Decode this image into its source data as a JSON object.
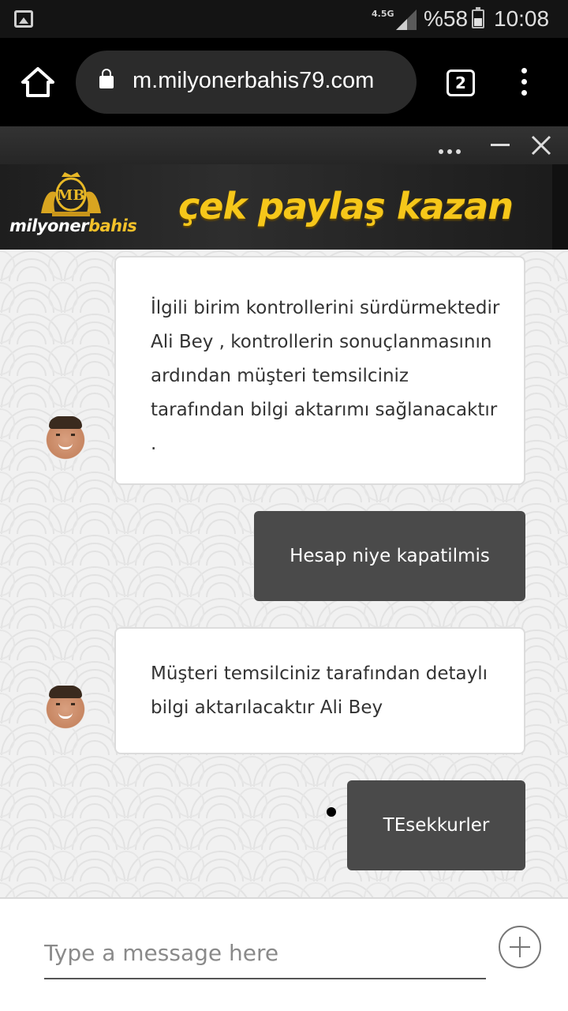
{
  "status_bar": {
    "network": "4.5G",
    "battery_percent": "%58",
    "time": "10:08"
  },
  "browser": {
    "url": "m.milyonerbahis79.com",
    "tab_count": "2"
  },
  "banner": {
    "brand_part1": "milyoner",
    "brand_part2": "bahis",
    "slogan": "çek paylaş kazan"
  },
  "chat": {
    "messages": [
      {
        "from": "agent",
        "text": "İlgili birim kontrollerini sürdürmektedir Ali Bey , kontrollerin sonuçlanmasının ardından müşteri temsilciniz tarafından bilgi aktarımı sağlanacaktır ."
      },
      {
        "from": "user",
        "text": "Hesap niye kapatilmis"
      },
      {
        "from": "agent",
        "text": "Müşteri temsilciniz tarafından detaylı bilgi aktarılacaktır Ali Bey"
      },
      {
        "from": "user",
        "text": "TEsekkurler"
      }
    ]
  },
  "input": {
    "placeholder": "Type a message here"
  },
  "colors": {
    "accent_gold": "#f6c71a",
    "user_bubble": "#4a4a4a",
    "agent_bubble": "#ffffff"
  }
}
